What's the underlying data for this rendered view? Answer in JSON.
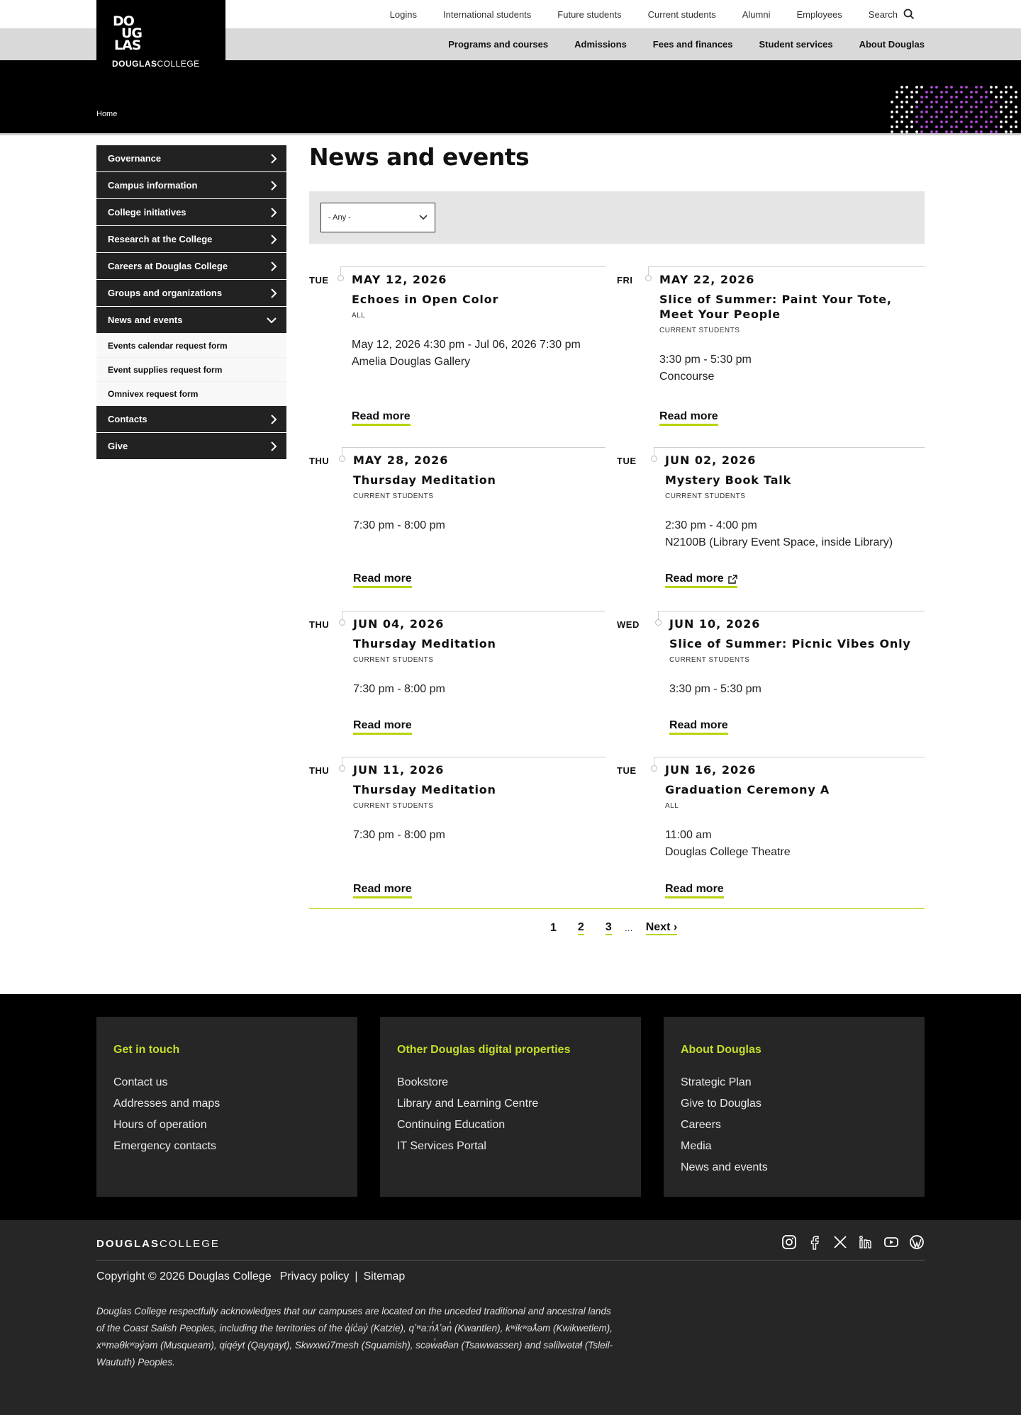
{
  "header": {
    "logo_mark": "DOUGLAS",
    "logo_word_bold": "DOUGLAS",
    "logo_word_light": "COLLEGE",
    "utility_links": [
      "Logins",
      "International students",
      "Future students",
      "Current students",
      "Alumni",
      "Employees"
    ],
    "search_label": "Search",
    "main_nav": [
      "Programs and courses",
      "Admissions",
      "Fees and finances",
      "Student services",
      "About Douglas"
    ],
    "breadcrumb": "Home"
  },
  "sidebar": {
    "items": [
      "Governance",
      "Campus information",
      "College initiatives",
      "Research at the College",
      "Careers at Douglas College",
      "Groups and organizations"
    ],
    "active": "News and events",
    "subitems": [
      "Events calendar request form",
      "Event supplies request form",
      "Omnivex request form"
    ],
    "after": [
      "Contacts",
      "Give"
    ]
  },
  "main": {
    "title": "News and events",
    "filter_value": "- Any -"
  },
  "events": [
    {
      "day": "TUE",
      "date": "MAY 12, 2026",
      "title": "Echoes in Open Color",
      "audience": "ALL",
      "time": "May 12, 2026 4:30 pm - Jul 06, 2026 7:30 pm",
      "location": "Amelia Douglas Gallery",
      "more": "Read more"
    },
    {
      "day": "FRI",
      "date": "MAY 22, 2026",
      "title": "Slice of Summer: Paint Your Tote, Meet Your People",
      "audience": "CURRENT STUDENTS",
      "time": "3:30 pm - 5:30 pm",
      "location": "Concourse",
      "more": "Read more"
    },
    {
      "day": "THU",
      "date": "MAY 28, 2026",
      "title": "Thursday Meditation",
      "audience": "CURRENT STUDENTS",
      "time": "7:30 pm - 8:00 pm",
      "location": "",
      "more": "Read more"
    },
    {
      "day": "TUE",
      "date": "JUN 02, 2026",
      "title": "Mystery Book Talk",
      "audience": "CURRENT STUDENTS",
      "time": "2:30 pm - 4:00 pm",
      "location": "N2100B (Library Event Space, inside Library)",
      "more": "Read more"
    },
    {
      "day": "THU",
      "date": "JUN 04, 2026",
      "title": "Thursday Meditation",
      "audience": "CURRENT STUDENTS",
      "time": "7:30 pm - 8:00 pm",
      "location": "",
      "more": "Read more"
    },
    {
      "day": "WED",
      "date": "JUN 10, 2026",
      "title": "Slice of Summer: Picnic Vibes Only",
      "audience": "CURRENT STUDENTS",
      "time": "3:30 pm - 5:30 pm",
      "location": "",
      "more": "Read more"
    },
    {
      "day": "THU",
      "date": "JUN 11, 2026",
      "title": "Thursday Meditation",
      "audience": "CURRENT STUDENTS",
      "time": "7:30 pm - 8:00 pm",
      "location": "",
      "more": "Read more"
    },
    {
      "day": "TUE",
      "date": "JUN 16, 2026",
      "title": "Graduation Ceremony A",
      "audience": "ALL",
      "time": "11:00 am",
      "location": "Douglas College Theatre",
      "more": "Read more"
    }
  ],
  "pager": {
    "current": "1",
    "pages": [
      "2",
      "3"
    ],
    "ellipsis": "…",
    "next": "Next ›"
  },
  "footer": {
    "cards": [
      {
        "heading": "Get in touch",
        "links": [
          "Contact us",
          "Addresses and maps",
          "Hours of operation",
          "Emergency contacts"
        ]
      },
      {
        "heading": "Other Douglas digital properties",
        "links": [
          "Bookstore",
          "Library and Learning Centre",
          "Continuing Education",
          "IT Services Portal"
        ]
      },
      {
        "heading": "About Douglas",
        "links": [
          "Strategic Plan",
          "Give to Douglas",
          "Careers",
          "Media",
          "News and events"
        ]
      }
    ],
    "logo_bold": "DOUGLAS",
    "logo_light": "COLLEGE",
    "social_icons": [
      "instagram-icon",
      "facebook-icon",
      "x-icon",
      "linkedin-icon",
      "youtube-icon",
      "wordpress-icon"
    ],
    "copyright": "Copyright © 2026 Douglas College",
    "privacy": "Privacy policy",
    "separator": "|",
    "sitemap": "Sitemap",
    "acknowledgement": "Douglas College respectfully acknowledges that our campuses are located on the unceded traditional and ancestral lands of the Coast Salish Peoples, including the territories of the q̓íc̓əy̓ (Katzie), qʼʷa:n̓ƛʼən̓ (Kwantlen), kʷikʷəƛ̓əm (Kwikwetlem), xʷməθkʷəy̓əm (Musqueam), qiqéyt (Qayqayt), Skwxwú7mesh (Squamish), scəw̓aθən (Tsawwassen) and səlilwətaɬ (Tsleil-Waututh) Peoples."
  },
  "colors": {
    "accent": "#b9d30d",
    "footer_heading": "#c6dd2a",
    "dark": "#222222"
  }
}
